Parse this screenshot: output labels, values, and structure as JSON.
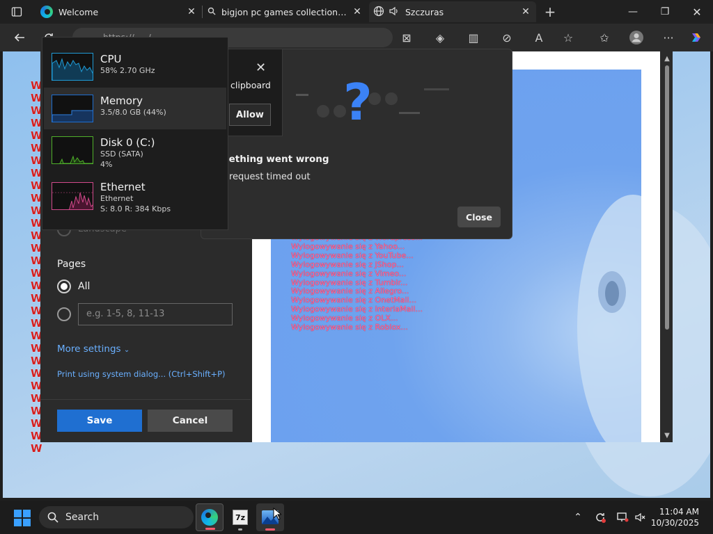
{
  "browser": {
    "tabs": [
      {
        "title": "Welcome",
        "icon": "edge-icon"
      },
      {
        "title": "bigjon pc games collection - Sear",
        "icon": "search-icon"
      },
      {
        "title": "Szczuras",
        "icon": "globe-icon",
        "audio": true
      }
    ],
    "address_url": "https://...../"
  },
  "page": {
    "wtext": [
      "W",
      "W",
      "W",
      "W",
      "W",
      "W",
      "W",
      "W",
      "W",
      "W",
      "W",
      "W",
      "W",
      "W",
      "W",
      "W",
      "W",
      "W",
      "W",
      "W",
      "W",
      "W",
      "W",
      "W",
      "W",
      "W",
      "W",
      "W",
      "W",
      "W"
    ],
    "preview_lines": [
      "Wylogowywanie się z Wordpress...",
      "Wylogowywanie się z Yahoo...",
      "Wylogowywanie się z YouTube...",
      "Wylogowywanie się z JShop...",
      "Wylogowywanie się z Vimeo...",
      "Wylogowywanie się z Tumblr...",
      "Wylogowywanie się z Allegro...",
      "Wylogowywanie się z OnetMail...",
      "Wylogowywanie się z InteriaMail...",
      "Wylogowywanie się z OLX...",
      "Wylogowywanie się z Roblox..."
    ]
  },
  "print_dialog": {
    "landscape_label": "Landscape",
    "pages_label": "Pages",
    "all_label": "All",
    "pages_placeholder": "e.g. 1-5, 8, 11-13",
    "more_settings": "More settings",
    "system_dialog": "Print using system dialog... (Ctrl+Shift+P)",
    "save": "Save",
    "cancel": "Cancel"
  },
  "error_dialog": {
    "title": "nething went wrong",
    "message": "request timed out",
    "close": "Close"
  },
  "clipboard_popup": {
    "text": "clipboard",
    "allow": "Allow"
  },
  "task_manager": {
    "items": [
      {
        "name": "CPU",
        "sub1": "58%  2.70 GHz",
        "sub2": "",
        "color": "#1f9bd6",
        "selected": false
      },
      {
        "name": "Memory",
        "sub1": "3.5/8.0 GB (44%)",
        "sub2": "",
        "color": "#1f6fd1",
        "selected": true
      },
      {
        "name": "Disk 0 (C:)",
        "sub1": "SSD (SATA)",
        "sub2": "4%",
        "color": "#4fb02a",
        "selected": false
      },
      {
        "name": "Ethernet",
        "sub1": "Ethernet",
        "sub2": "S: 8.0  R: 384 Kbps",
        "color": "#d14a8b",
        "selected": false
      }
    ]
  },
  "taskbar": {
    "search": "Search",
    "time": "11:04 AM",
    "date": "10/30/2025",
    "apps": [
      "edge-icon",
      "7zip-icon",
      "photos-icon"
    ]
  },
  "colors": {
    "accent": "#1f6fd1",
    "error_q": "#3b82f6",
    "wtext": "#d42020",
    "preview_text": "#ff6aa0"
  }
}
